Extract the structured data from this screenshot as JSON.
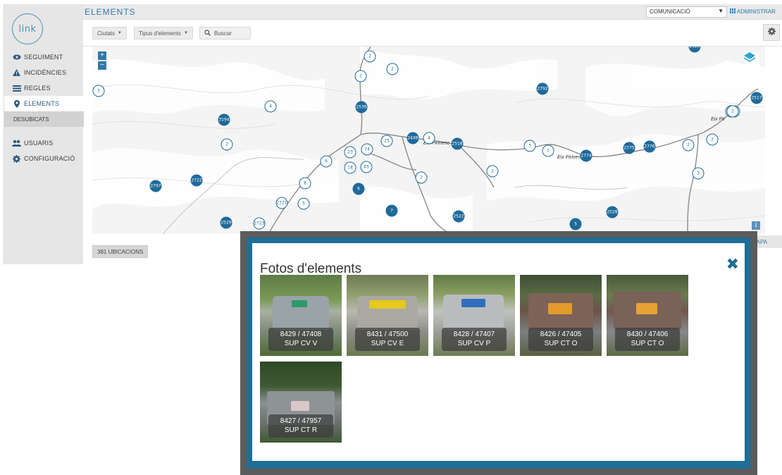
{
  "app": {
    "logo_text": "link"
  },
  "sidebar": {
    "items": [
      {
        "label": "SEGUIMENT",
        "icon": "eye-icon"
      },
      {
        "label": "INCIDÈNCIES",
        "icon": "warning-icon"
      },
      {
        "label": "REGLES",
        "icon": "rules-icon"
      },
      {
        "label": "ELEMENTS",
        "icon": "map-marker-icon"
      }
    ],
    "sub_item": "DESUBICATS",
    "items2": [
      {
        "label": "USUARIS",
        "icon": "users-icon"
      },
      {
        "label": "CONFIGURACIÓ",
        "icon": "gear-icon"
      }
    ]
  },
  "header": {
    "title": "ELEMENTS",
    "company_select": "COMUNICACIÓ",
    "admin_label": "ADMINISTRAR"
  },
  "toolbar": {
    "cities_label": "Ciutats",
    "types_label": "Tipus d'elements",
    "search_placeholder": "Buscar"
  },
  "map": {
    "zoom_in": "+",
    "zoom_out": "−",
    "road_labels": [
      "Eix Pirinenc",
      "Eix Pirinenc",
      "Eix Pir"
    ],
    "clusters": [
      "2",
      "2",
      "2",
      "2",
      "2792",
      "2517",
      "4",
      "2536",
      "2",
      "3194",
      "2",
      "2449",
      "4",
      "2518",
      "25",
      "74",
      "23",
      "6",
      "45",
      "18",
      "2",
      "3",
      "2",
      "2774",
      "2775",
      "2776",
      "2",
      "3",
      "2",
      "2",
      "8",
      "6",
      "2797",
      "2722",
      "2721",
      "5",
      "7",
      "2522",
      "2528",
      "2529",
      "2723",
      "5",
      "2526",
      "2",
      "2",
      "2"
    ],
    "info": "i"
  },
  "locations_count": "381 UBICACIONS",
  "view_map_label": "MAPA",
  "modal": {
    "title": "Fotos d'elements",
    "close": "✖",
    "photos": [
      {
        "id": "8429 / 47408",
        "type": "SUP CV V"
      },
      {
        "id": "8431 / 47500",
        "type": "SUP CV E"
      },
      {
        "id": "8428 / 47407",
        "type": "SUP CV P"
      },
      {
        "id": "8426 / 47405",
        "type": "SUP CT O"
      },
      {
        "id": "8430 / 47406",
        "type": "SUP CT O"
      },
      {
        "id": "8427 / 47957",
        "type": "SUP CT R"
      }
    ]
  },
  "colors": {
    "accent": "#2f7aa8",
    "modal_frame": "#1e6e96",
    "cluster": "#1f6a9a"
  }
}
